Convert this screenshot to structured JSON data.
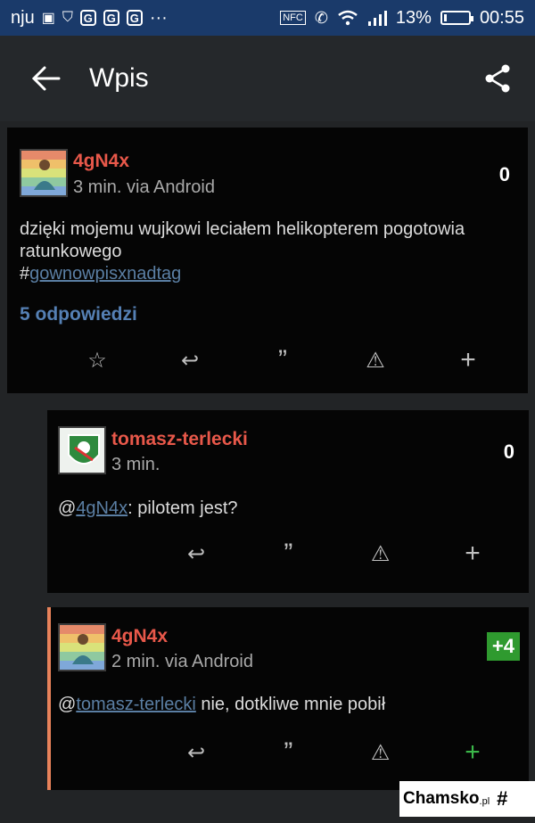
{
  "status_bar": {
    "carrier": "nju",
    "g_icons": [
      "G",
      "G",
      "G"
    ],
    "more": "···",
    "nfc": "NFC",
    "battery_percent": "13%",
    "battery_level": 0.13,
    "time": "00:55"
  },
  "app_bar": {
    "title": "Wpis",
    "back_icon": "arrow-left-icon",
    "share_icon": "share-icon"
  },
  "main_post": {
    "author": "4gN4x",
    "meta": "3 min. via Android",
    "score": "0",
    "text": "dzięki mojemu wujkowi leciałem helikopterem pogotowia ratunkowego",
    "hashtag_prefix": "#",
    "hashtag": "gownowpisxnadtag",
    "replies": "5 odpowiedzi",
    "actions": [
      "favorite-star-icon",
      "reply-icon",
      "quote-icon",
      "report-icon",
      "plus-icon"
    ],
    "action_glyphs": {
      "star": "☆",
      "reply": "↩",
      "quote": "”",
      "report": "⚠",
      "plus": "+"
    }
  },
  "comments": [
    {
      "author": "tomasz-terlecki",
      "meta": "3 min.",
      "score": "0",
      "mention": "4gN4x",
      "text": ": pilotem jest?"
    },
    {
      "author": "4gN4x",
      "meta": "2 min. via Android",
      "score": "+4",
      "mention": "tomasz-terlecki",
      "text": " nie, dotkliwe mnie pobił"
    }
  ],
  "comment_actions": {
    "reply": "↩",
    "quote": "”",
    "report": "⚠",
    "plus": "+"
  },
  "colors": {
    "accent_author": "#e8584a",
    "link": "#5b7fa4",
    "plus_badge": "#2f9a2f",
    "thread_bar": "#e8825a"
  },
  "watermark": {
    "brand": "Chamsko",
    "tld": ".pl"
  }
}
